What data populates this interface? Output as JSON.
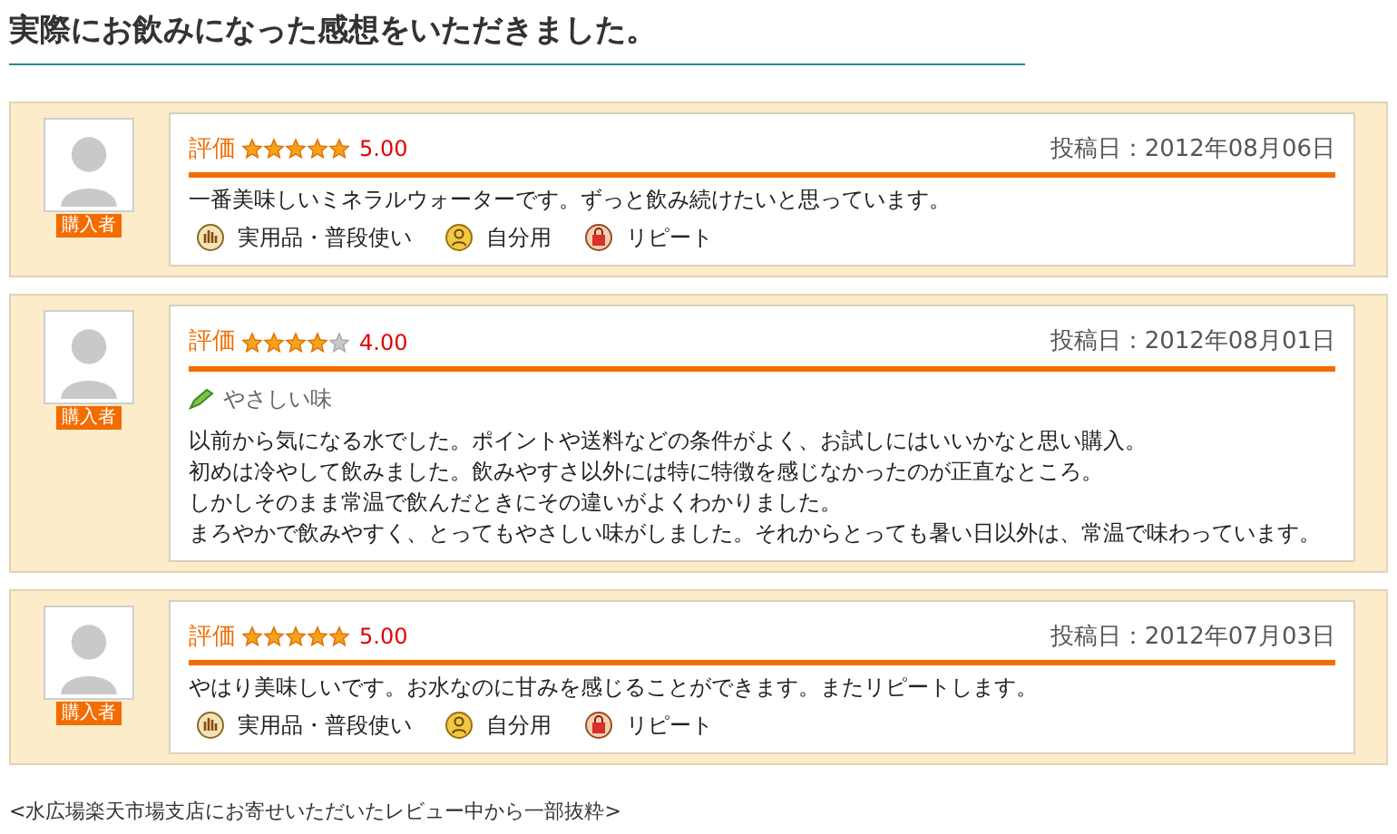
{
  "heading": "実際にお飲みになった感想をいただきました。",
  "reviews": [
    {
      "badge": "購入者",
      "rating_label": "評価",
      "stars": 5,
      "score": "5.00",
      "date": "投稿日：2012年08月06日",
      "body": [
        "一番美味しいミネラルウォーターです。ずっと飲み続けたいと思っています。"
      ],
      "tags": [
        {
          "kind": "use",
          "label": "実用品・普段使い"
        },
        {
          "kind": "self",
          "label": "自分用"
        },
        {
          "kind": "repeat",
          "label": "リピート"
        }
      ]
    },
    {
      "badge": "購入者",
      "rating_label": "評価",
      "stars": 4,
      "score": "4.00",
      "date": "投稿日：2012年08月01日",
      "title": "やさしい味",
      "body": [
        "以前から気になる水でした。ポイントや送料などの条件がよく、お試しにはいいかなと思い購入。",
        "初めは冷やして飲みました。飲みやすさ以外には特に特徴を感じなかったのが正直なところ。",
        "しかしそのまま常温で飲んだときにその違いがよくわかりました。",
        "まろやかで飲みやすく、とってもやさしい味がしました。それからとっても暑い日以外は、常温で味わっています。"
      ]
    },
    {
      "badge": "購入者",
      "rating_label": "評価",
      "stars": 5,
      "score": "5.00",
      "date": "投稿日：2012年07月03日",
      "body": [
        "やはり美味しいです。お水なのに甘みを感じることができます。またリピートします。"
      ],
      "tags": [
        {
          "kind": "use",
          "label": "実用品・普段使い"
        },
        {
          "kind": "self",
          "label": "自分用"
        },
        {
          "kind": "repeat",
          "label": "リピート"
        }
      ]
    }
  ],
  "footnote": "<水広場楽天市場支店にお寄せいただいたレビュー中から一部抜粋>"
}
